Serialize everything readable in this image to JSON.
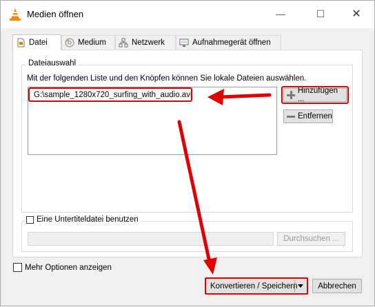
{
  "window": {
    "title": "Medien öffnen",
    "minimize_glyph": "—",
    "maximize_glyph": "☐",
    "close_glyph": "✕"
  },
  "tabs": [
    {
      "label": "Datei",
      "icon": "file-icon",
      "active": true
    },
    {
      "label": "Medium",
      "icon": "disc-icon",
      "active": false
    },
    {
      "label": "Netzwerk",
      "icon": "network-icon",
      "active": false
    },
    {
      "label": "Aufnahmegerät öffnen",
      "icon": "capture-device-icon",
      "active": false
    }
  ],
  "file_section": {
    "title": "Dateiauswahl",
    "instruction": "Mit der folgenden Liste und den Knöpfen können Sie lokale Dateien auswählen.",
    "files": [
      "G:\\sample_1280x720_surfing_with_audio.avi"
    ],
    "add_label": "Hinzufügen ...",
    "remove_label": "Entfernen"
  },
  "subtitle_section": {
    "checkbox_label": "Eine Untertiteldatei benutzen",
    "checked": false,
    "path_value": "",
    "browse_label": "Durchsuchen ..."
  },
  "more_options_label": "Mehr Optionen anzeigen",
  "footer": {
    "convert_label": "Konvertieren / Speichern",
    "cancel_label": "Abbrechen"
  },
  "annotation_color": "#e00000"
}
